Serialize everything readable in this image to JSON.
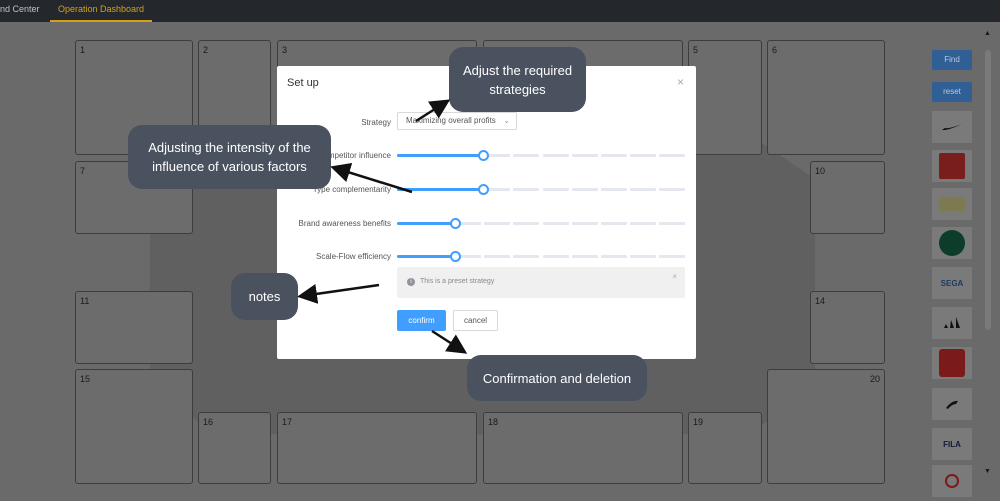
{
  "topbar": {
    "tab_command": "nd Center",
    "tab_dashboard": "Operation Dashboard"
  },
  "cells": [
    "1",
    "2",
    "3",
    "5",
    "6",
    "7",
    "10",
    "11",
    "14",
    "15",
    "16",
    "17",
    "18",
    "19",
    "20"
  ],
  "sidebar": {
    "find_label": "Find",
    "reset_label": "reset",
    "logos": [
      "nike-logo",
      "kfc-logo",
      "brand-logo",
      "starbucks-logo",
      "SEGA",
      "adidas-logo",
      "switch-logo",
      "puma-logo",
      "FILA",
      "brand-logo"
    ]
  },
  "dialog": {
    "title": "Set up",
    "close_symbol": "×",
    "strategy_label": "Strategy",
    "strategy_value": "Maximizing overall profits",
    "sliders": [
      {
        "label": "Competitor influence",
        "value": 0.3
      },
      {
        "label": "Type complementarity",
        "value": 0.3
      },
      {
        "label": "Brand awareness benefits",
        "value": 0.2
      },
      {
        "label": "Scale-Flow efficiency",
        "value": 0.2
      }
    ],
    "note_text": "This is a preset strategy",
    "note_close": "×",
    "confirm_label": "confirm",
    "cancel_label": "cancel"
  },
  "callouts": {
    "strategies": "Adjust the required strategies",
    "intensity": "Adjusting the intensity of the influence of various factors",
    "notes": "notes",
    "confirm": "Confirmation and deletion"
  }
}
